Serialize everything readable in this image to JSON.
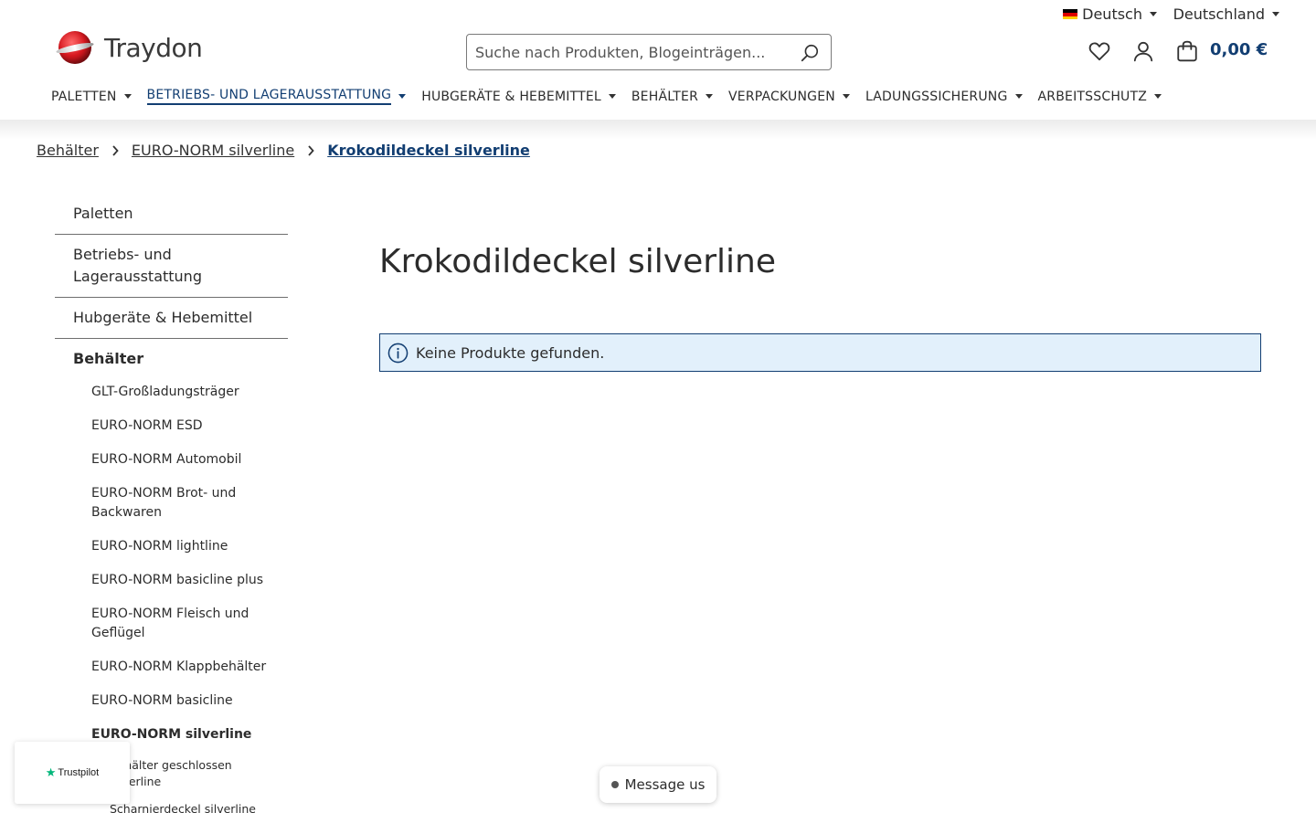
{
  "topbar": {
    "language": "Deutsch",
    "country": "Deutschland"
  },
  "header": {
    "logo_text": "Traydon",
    "search_placeholder": "Suche nach Produkten, Blogeinträgen...",
    "cart_total": "0,00 €"
  },
  "mainnav": {
    "items": [
      {
        "label": "PALETTEN"
      },
      {
        "label": "BETRIEBS- UND LAGERAUSSTATTUNG"
      },
      {
        "label": "HUBGERÄTE & HEBEMITTEL"
      },
      {
        "label": "BEHÄLTER"
      },
      {
        "label": "VERPACKUNGEN"
      },
      {
        "label": "LADUNGSSICHERUNG"
      },
      {
        "label": "ARBEITSSCHUTZ"
      }
    ]
  },
  "breadcrumb": {
    "items": [
      "Behälter",
      "EURO-NORM silverline",
      "Krokodildeckel silverline"
    ]
  },
  "sidebar": {
    "top_items": [
      "Paletten",
      "Betriebs- und Lagerausstattung",
      "Hubgeräte & Hebemittel"
    ],
    "active_item": "Behälter",
    "sub_items": [
      "GLT-Großladungsträger",
      "EURO-NORM ESD",
      "EURO-NORM Automobil",
      "EURO-NORM Brot- und Backwaren",
      "EURO-NORM lightline",
      "EURO-NORM basicline plus",
      "EURO-NORM Fleisch und Geflügel",
      "EURO-NORM Klappbehälter",
      "EURO-NORM basicline",
      "EURO-NORM silverline"
    ],
    "subsub_items": [
      "Behälter geschlossen silverline",
      "Scharnierdeckel silverline"
    ]
  },
  "main": {
    "title": "Krokodildeckel silverline",
    "alert_text": "Keine Produkte gefunden."
  },
  "widgets": {
    "trustpilot_label": "Trustpilot",
    "message_label": "Message us"
  },
  "colors": {
    "brand_blue": "#123e72",
    "brand_red": "#d71920",
    "alert_bg": "#e2f0fb"
  }
}
